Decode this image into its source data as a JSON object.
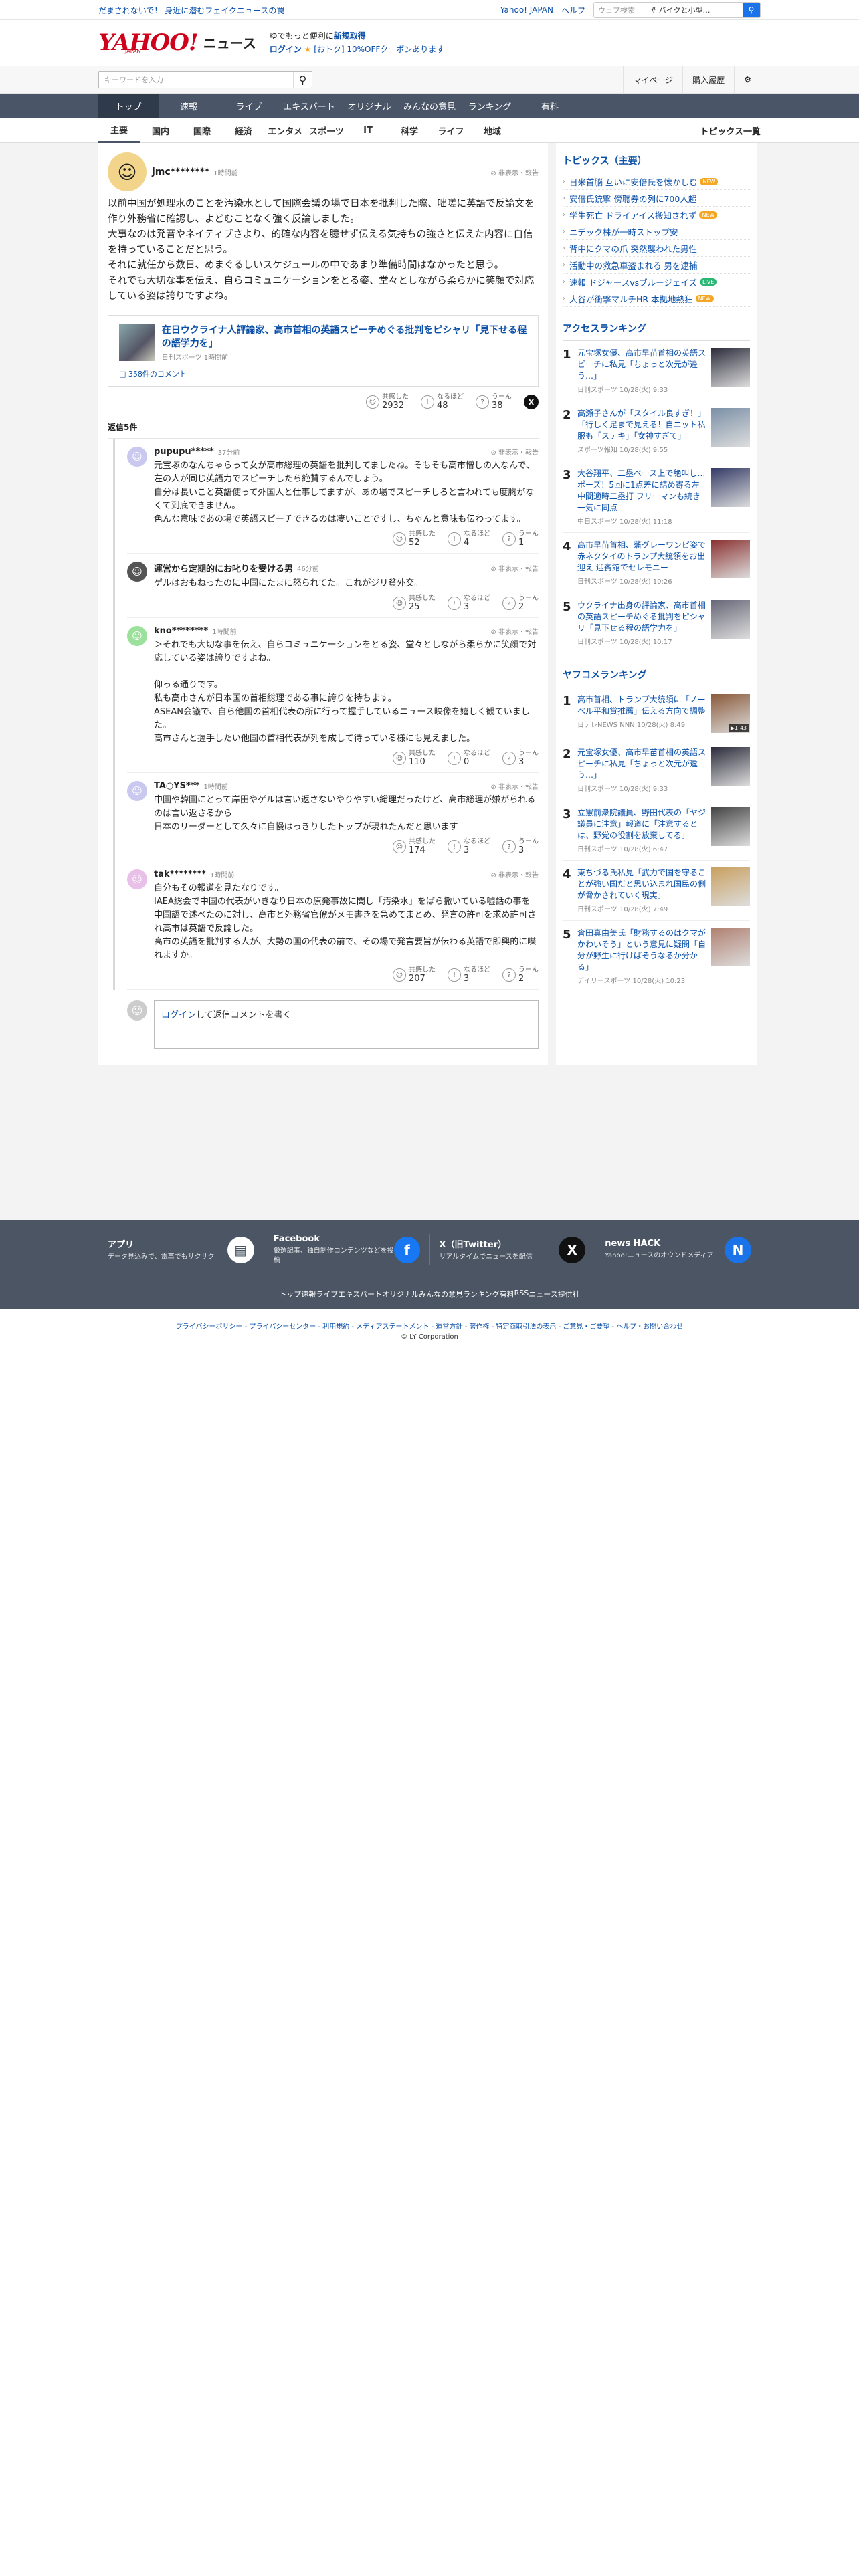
{
  "topbar": {
    "notice": "だまされないで！ 身近に潜むフェイクニュースの罠",
    "links": [
      "Yahoo! JAPAN",
      "ヘルプ"
    ],
    "search_placeholder": "ウェブ検索",
    "search_value": "# バイクと小型…"
  },
  "header": {
    "logo": "YAHOO!",
    "logo_sub": "JAPAN",
    "logo_news": "ニュース",
    "promo1_pre": "ゆでもっと便利に",
    "promo1_bold": "新規取得",
    "promo2_login": "ログイン",
    "promo2_coupon": "[おトク] 10%OFFクーポンあります"
  },
  "subbar": {
    "kw_placeholder": "キーワードを入力",
    "btns": [
      "マイページ",
      "購入履歴"
    ]
  },
  "gnav": [
    "トップ",
    "速報",
    "ライブ",
    "エキスパート",
    "オリジナル",
    "みんなの意見",
    "ランキング",
    "有料"
  ],
  "cnav": [
    "主要",
    "国内",
    "国際",
    "経済",
    "エンタメ",
    "スポーツ",
    "IT",
    "科学",
    "ライフ",
    "地域"
  ],
  "cnav_all": "トピックス一覧",
  "comment": {
    "name": "jmc********",
    "time": "1時間前",
    "report": "非表示・報告",
    "text": [
      "以前中国が処理水のことを汚染水として国際会議の場で日本を批判した際、咄嗟に英語で反論文を作り外務省に確認し、よどむことなく強く反論しました。",
      "大事なのは発音やネイティブさより、的確な内容を臆せず伝える気持ちの強さと伝えた内容に自信を持っていることだと思う。",
      "それに就任から数日、めまぐるしいスケジュールの中であまり準備時間はなかったと思う。",
      "それでも大切な事を伝え、自らコミュニケーションをとる姿、堂々としながら柔らかに笑顔で対応している姿は誇りですよね。"
    ],
    "quote_title": "在日ウクライナ人評論家、高市首相の英語スピーチめぐる批判をピシャリ「見下せる程の語学力を」",
    "quote_meta": "日刊スポーツ 1時間前",
    "quote_comments": "358件のコメント",
    "reactions": [
      {
        "label": "共感した",
        "num": "2932"
      },
      {
        "label": "なるほど",
        "num": "48"
      },
      {
        "label": "うーん",
        "num": "38"
      }
    ]
  },
  "replies_header": "返信5件",
  "replies": [
    {
      "name": "pupupu*****",
      "time": "37分前",
      "text": "元宝塚のなんちゃらって女が高市総理の英語を批判してましたね。そもそも高市憎しの人なんで、左の人が同じ英語力でスピーチしたら絶賛するんでしょう。\n自分は長いこと英語使って外国人と仕事してますが、あの場でスピーチしろと言われても度胸がなくて到底できません。\n色んな意味であの場で英語スピーチできるのは凄いことですし、ちゃんと意味も伝わってます。",
      "r": [
        "52",
        "4",
        "1"
      ],
      "color": "#c9c9f0"
    },
    {
      "name": "運営から定期的にお叱りを受ける男",
      "time": "46分前",
      "text": "ゲルはおもねったのに中国にたまに怒られてた。これがジリ貧外交。",
      "r": [
        "25",
        "3",
        "2"
      ],
      "color": "#555"
    },
    {
      "name": "kno********",
      "time": "1時間前",
      "text": "＞それでも大切な事を伝え、自らコミュニケーションをとる姿、堂々としながら柔らかに笑顔で対応している姿は誇りですよね。\n\n仰っる通りです。\n私も高市さんが日本国の首相総理である事に誇りを持ちます。\nASEAN会議で、自ら他国の首相代表の所に行って握手しているニュース映像を嬉しく観ていました。\n高市さんと握手したい他国の首相代表が列を成して待っている様にも見えました。",
      "r": [
        "110",
        "0",
        "3"
      ],
      "color": "#9be09b"
    },
    {
      "name": "TA○YS***",
      "time": "1時間前",
      "text": "中国や韓国にとって岸田やゲルは言い返さないやりやすい総理だったけど、高市総理が嫌がられるのは言い返さるから\n日本のリーダーとして久々に自慢はっきりしたトップが現れたんだと思います",
      "r": [
        "174",
        "3",
        "3"
      ],
      "color": "#c9c9f0"
    },
    {
      "name": "tak********",
      "time": "1時間前",
      "text": "自分もその報道を見たなりです。\nIAEA総会で中国の代表がいきなり日本の原発事故に関し「汚染水」をばら撒いている嘘話の事を中国語で述べたのに対し、高市と外務省官僚がメモ書きを急めてまとめ、発言の許可を求め許可され高市は英語で反論した。\n高市の英語を批判する人が、大勢の国の代表の前で、その場で発言要旨が伝わる英語で即興的に喋れますか。",
      "r": [
        "207",
        "3",
        "2"
      ],
      "color": "#e8c0e8"
    }
  ],
  "reply_input": {
    "login": "ログイン",
    "rest": "して返信コメントを書く"
  },
  "topics": {
    "title": "トピックス（主要）",
    "items": [
      {
        "t": "日米首脳 互いに安倍氏を懐かしむ",
        "b": "new"
      },
      {
        "t": "安倍氏銃撃 傍聴券の列に700人超",
        "b": ""
      },
      {
        "t": "学生死亡 ドライアイス搬知されず",
        "b": "new"
      },
      {
        "t": "ニデック株が一時ストップ安",
        "b": ""
      },
      {
        "t": "背中にクマの爪 突然襲われた男性",
        "b": ""
      },
      {
        "t": "活動中の救急車盗まれる 男を逮捕",
        "b": ""
      },
      {
        "t": "速報 ドジャースvsブルージェイズ",
        "b": "live"
      },
      {
        "t": "大谷が衝撃マルチHR 本拠地熱狂",
        "b": "new"
      }
    ],
    "new_label": "NEW",
    "live_label": "LIVE"
  },
  "access": {
    "title": "アクセスランキング",
    "items": [
      {
        "t": "元宝塚女優、高市早苗首相の英語スピーチに私見「ちょっと次元が違う…」",
        "m": "日刊スポーツ 10/28(火) 9:33",
        "c": "#2a2a3a"
      },
      {
        "t": "高瀬子さんが「スタイル良すぎ！」「行しく足まで見える！自ニット私服も「ステキ」「女神すぎて」",
        "m": "スポーツ報知 10/28(火) 9:55",
        "c": "#7a8fa6"
      },
      {
        "t": "大谷翔平、二塁ベース上で絶叫し…ポーズ！5回に1点差に詰め寄る左中間適時二塁打 フリーマンも続き一気に同点",
        "m": "中日スポーツ 10/28(火) 11:18",
        "c": "#333a66"
      },
      {
        "t": "高市早苗首相、藩グレーワンピ姿で赤ネクタイのトランプ大統領をお出迎え 迎賓館でセレモニー",
        "m": "日刊スポーツ 10/28(火) 10:26",
        "c": "#8a3030"
      },
      {
        "t": "ウクライナ出身の評論家、高市首相の英語スピーチめぐる批判をピシャリ「見下せる程の語学力を」",
        "m": "日刊スポーツ 10/28(火) 10:17",
        "c": "#667"
      }
    ]
  },
  "yahoo_rank": {
    "title": "ヤフコメランキング",
    "items": [
      {
        "t": "高市首相、トランプ大統領に「ノーベル平和賞推薦」伝える方向で調整",
        "m": "日テレNEWS NNN 10/28(火) 8:49",
        "c": "#8a5a3a",
        "v": "▶1:43"
      },
      {
        "t": "元宝塚女優、高市早苗首相の英語スピーチに私見「ちょっと次元が違う…」",
        "m": "日刊スポーツ 10/28(火) 9:33",
        "c": "#2a2a3a",
        "v": ""
      },
      {
        "t": "立憲前衆院議員、野田代表の「ヤジ議員に注意」報道に「注意するとは、野党の役割を放棄してる」",
        "m": "日刊スポーツ 10/28(火) 6:47",
        "c": "#444",
        "v": ""
      },
      {
        "t": "東ちづる氏私見「武力で国を守ることが強い国だと思い込まれ国民の側が脅かされていく現実」",
        "m": "日刊スポーツ 10/28(火) 7:49",
        "c": "#c9a060",
        "v": ""
      },
      {
        "t": "倉田真由美氏「財務するのはクマがかわいそう」という意見に疑問「自分が野生に行けばそうなるか分かる」",
        "m": "デイリースポーツ 10/28(火) 10:23",
        "c": "#b08070",
        "v": ""
      }
    ]
  },
  "footer": {
    "cols": [
      {
        "t": "アプリ",
        "d": "データ見込みで、電車でもサクサク",
        "i": "▤"
      },
      {
        "t": "Facebook",
        "d": "厳選記事、独自制作コンテンツなどを投稿",
        "i": "f"
      },
      {
        "t": "X（旧Twitter）",
        "d": "リアルタイムでニュースを配信",
        "i": "X"
      },
      {
        "t": "news HACK",
        "d": "Yahoo!ニュースのオウンドメディア",
        "i": "N"
      }
    ],
    "nav": [
      "トップ",
      "速報",
      "ライブ",
      "エキスパート",
      "オリジナル",
      "みんなの意見",
      "ランキング",
      "有料",
      "RSS",
      "ニュース提供社"
    ],
    "legal": "プライバシーポリシー - プライバシーセンター - 利用規約 - メディアステートメント - 運営方針 - 著作権 - 特定商取引法の表示 - ご意見・ご要望 - ヘルプ・お問い合わせ",
    "copy": "© LY Corporation"
  },
  "colors": {
    "brand": "#d0021b",
    "link": "#0a4fa8",
    "nav": "#4a5568"
  }
}
